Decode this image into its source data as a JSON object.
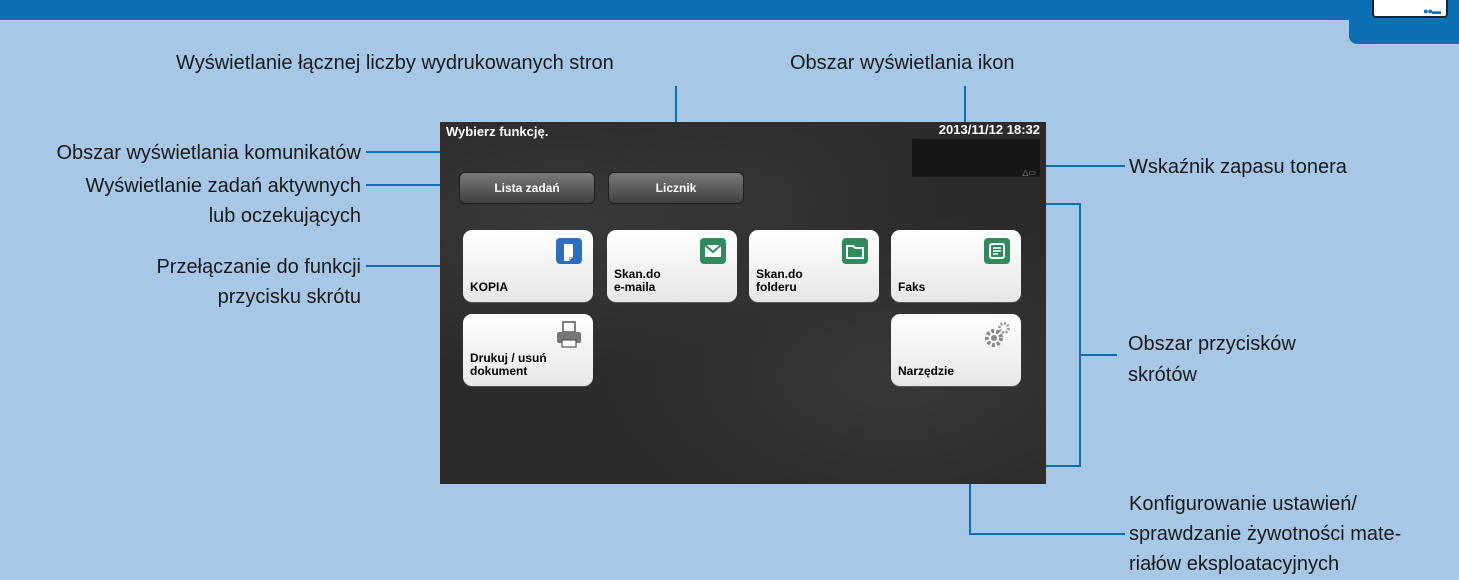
{
  "annotations": {
    "message_area": "Obszar wyświetlania komunikatów",
    "active_jobs": [
      "Wyświetlanie zadań aktywnych",
      "lub oczekujących"
    ],
    "shortcut_switch": [
      "Przełączanie do funkcji",
      "przycisku skrótu"
    ],
    "total_pages": "Wyświetlanie łącznej liczby wydrukowanych stron",
    "icon_area": "Obszar wyświetlania ikon",
    "toner_indicator": "Wskaźnik zapasu tonera",
    "shortcut_area": [
      "Obszar przycisków",
      "skrótów"
    ],
    "settings": [
      "Konfigurowanie ustawień/",
      "sprawdzanie żywotności mate-",
      "riałów eksploatacyjnych"
    ]
  },
  "screen": {
    "message": "Wybierz funkcję.",
    "datetime": "2013/11/12 18:32",
    "job_list_label": "Lista zadań",
    "counter_label": "Licznik",
    "tiles": [
      {
        "label": "KOPIA",
        "icon": "copy-icon"
      },
      {
        "label": "Skan.do\ne-maila",
        "icon": "envelope-icon"
      },
      {
        "label": "Skan.do\nfolderu",
        "icon": "folder-icon"
      },
      {
        "label": "Faks",
        "icon": "fax-icon"
      },
      {
        "label": "Drukuj / usuń\ndokument",
        "icon": "printer-icon"
      },
      {
        "label": "Narzędzie",
        "icon": "gear-icon"
      }
    ]
  },
  "colors": {
    "header_blue": "#0a6fb5",
    "background": "#a7c7e7",
    "icon_blue": "#2c6fbe",
    "icon_green": "#2f8a5e"
  }
}
